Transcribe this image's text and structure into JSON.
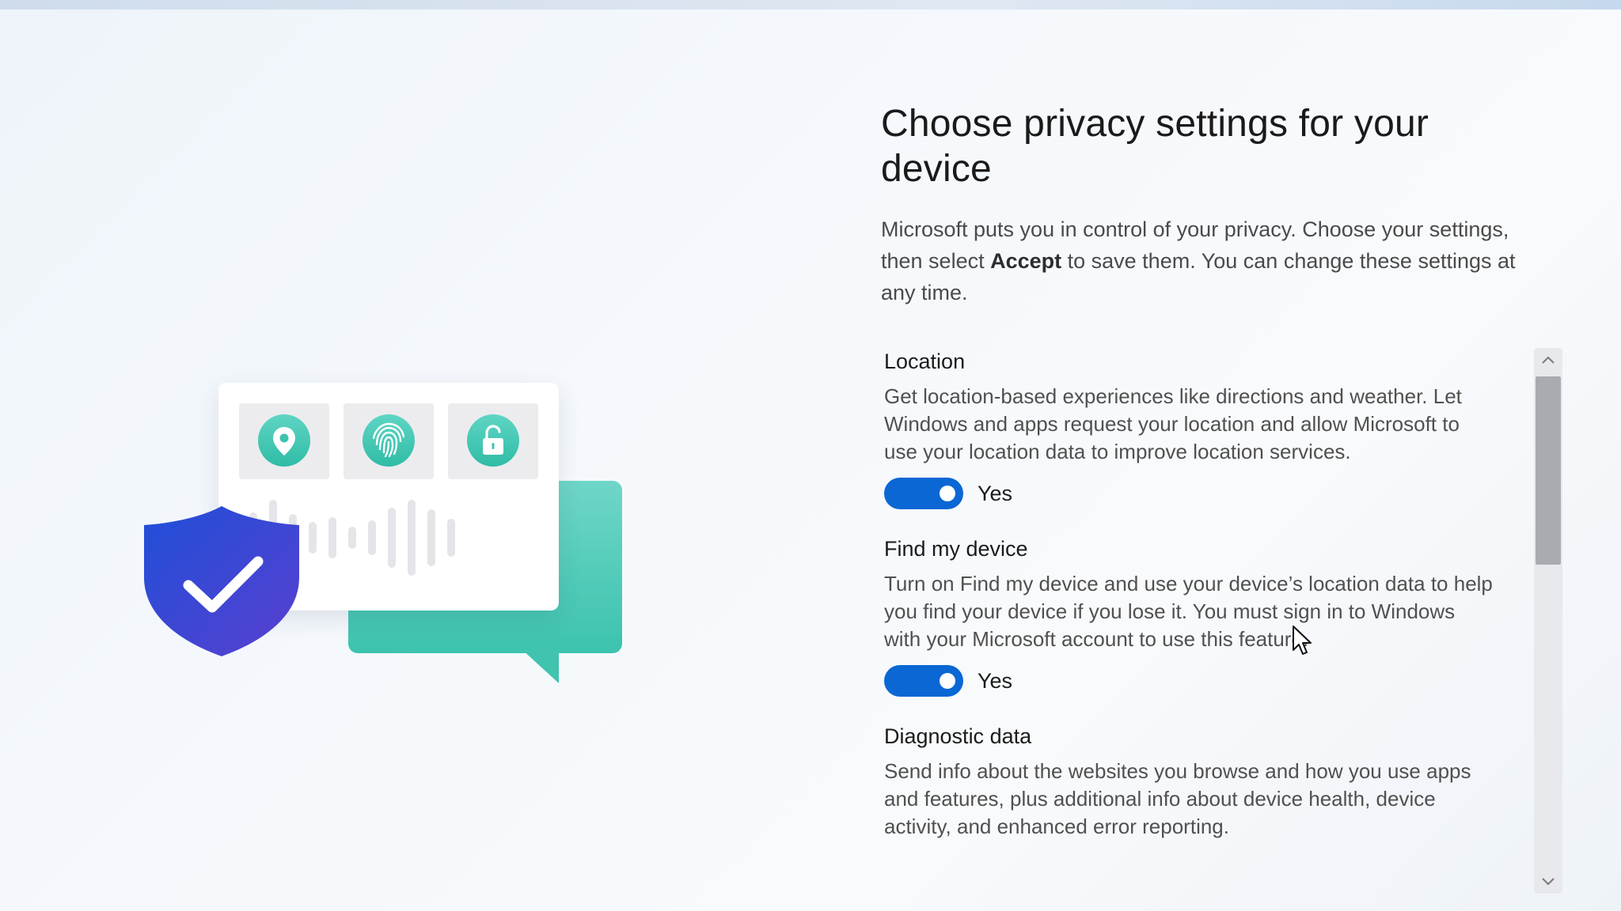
{
  "page": {
    "title": "Choose privacy settings for your device",
    "intro_before": "Microsoft puts you in control of your privacy. Choose your settings, then select ",
    "intro_bold": "Accept",
    "intro_after": " to save them. You can change these settings at any time."
  },
  "illustration": {
    "icons": [
      "location-pin-icon",
      "fingerprint-icon",
      "unlock-icon",
      "shield-check-icon"
    ],
    "colors": {
      "teal": "#3cc3ae",
      "shield_blue": "#1f4fd8",
      "shield_purple": "#5a3fd0"
    }
  },
  "settings": [
    {
      "title": "Location",
      "description": "Get location-based experiences like directions and weather. Let Windows and apps request your location and allow Microsoft to use your location data to improve location services.",
      "toggle_on": true,
      "toggle_label": "Yes"
    },
    {
      "title": "Find my device",
      "description": "Turn on Find my device and use your device’s location data to help you find your device if you lose it. You must sign in to Windows with your Microsoft account to use this feature.",
      "toggle_on": true,
      "toggle_label": "Yes"
    },
    {
      "title": "Diagnostic data",
      "description": "Send info about the websites you browse and how you use apps and features, plus additional info about device health, device activity, and enhanced error reporting."
    }
  ],
  "scrollbar": {
    "up_icon": "chevron-up-icon",
    "down_icon": "chevron-down-icon"
  },
  "colors": {
    "accent": "#0a67d4",
    "background": "#f4f7fb"
  }
}
